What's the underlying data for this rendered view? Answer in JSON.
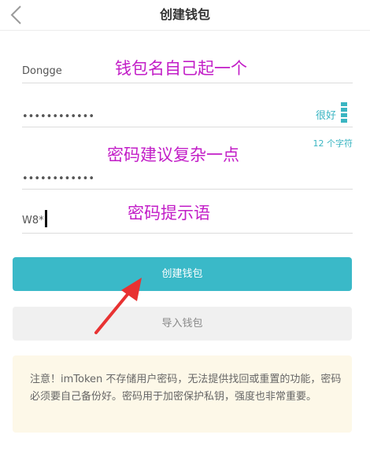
{
  "nav": {
    "title": "创建钱包"
  },
  "form": {
    "wallet_name": {
      "value": "Dongge"
    },
    "password": {
      "value": "••••••••••••",
      "strength_label": "很好"
    },
    "password_hint_count": "12 个字符",
    "password_confirm": {
      "value": "••••••••••••"
    },
    "hint": {
      "value": "W8*"
    }
  },
  "annotations": {
    "name": "钱包名自己起一个",
    "password": "密码建议复杂一点",
    "hint": "密码提示语"
  },
  "buttons": {
    "create": "创建钱包",
    "import": "导入钱包"
  },
  "notice": {
    "text": "注意！imToken 不存储用户密码，无法提供找回或重置的功能，密码必须要自己备份好。密码用于加密保护私钥，强度也非常重要。"
  },
  "colors": {
    "accent": "#3ab9c8",
    "annotation": "#c21dc7"
  }
}
